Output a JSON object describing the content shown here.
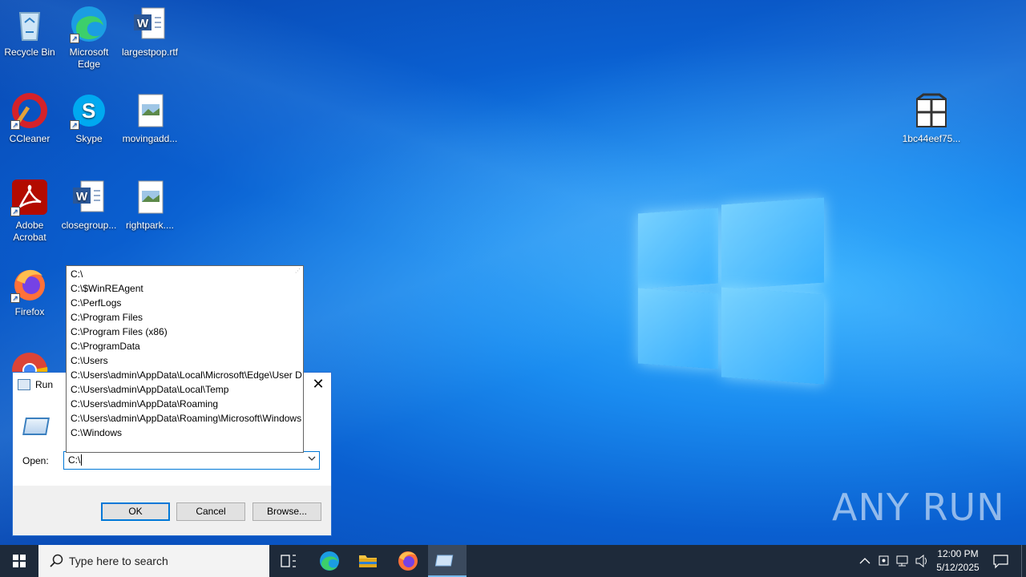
{
  "desktop": {
    "icons": [
      {
        "label": "Recycle Bin",
        "icon": "recycle-bin-icon"
      },
      {
        "label": "Microsoft Edge",
        "icon": "edge-icon"
      },
      {
        "label": "largestpop.rtf",
        "icon": "word-doc-icon"
      },
      {
        "label": "CCleaner",
        "icon": "ccleaner-icon"
      },
      {
        "label": "Skype",
        "icon": "skype-icon"
      },
      {
        "label": "movingadd...",
        "icon": "image-file-icon"
      },
      {
        "label": "Adobe Acrobat",
        "icon": "acrobat-icon"
      },
      {
        "label": "closegroup...",
        "icon": "word-doc-icon"
      },
      {
        "label": "rightpark....",
        "icon": "image-file-icon"
      },
      {
        "label": "Firefox",
        "icon": "firefox-icon"
      },
      {
        "label": "",
        "icon": "chrome-icon"
      },
      {
        "label": "1bc44eef75...",
        "icon": "package-icon"
      }
    ]
  },
  "run_dialog": {
    "title": "Run",
    "open_label": "Open:",
    "input_value": "C:\\",
    "ok_label": "OK",
    "cancel_label": "Cancel",
    "browse_label": "Browse..."
  },
  "autocomplete": {
    "items": [
      "C:\\",
      "C:\\$WinREAgent",
      "C:\\PerfLogs",
      "C:\\Program Files",
      "C:\\Program Files (x86)",
      "C:\\ProgramData",
      "C:\\Users",
      "C:\\Users\\admin\\AppData\\Local\\Microsoft\\Edge\\User D",
      "C:\\Users\\admin\\AppData\\Local\\Temp",
      "C:\\Users\\admin\\AppData\\Roaming",
      "C:\\Users\\admin\\AppData\\Roaming\\Microsoft\\Windows",
      "C:\\Windows"
    ]
  },
  "taskbar": {
    "search_placeholder": "Type here to search",
    "time": "12:00 PM",
    "date": "5/12/2025"
  },
  "watermark": "ANY RUN"
}
